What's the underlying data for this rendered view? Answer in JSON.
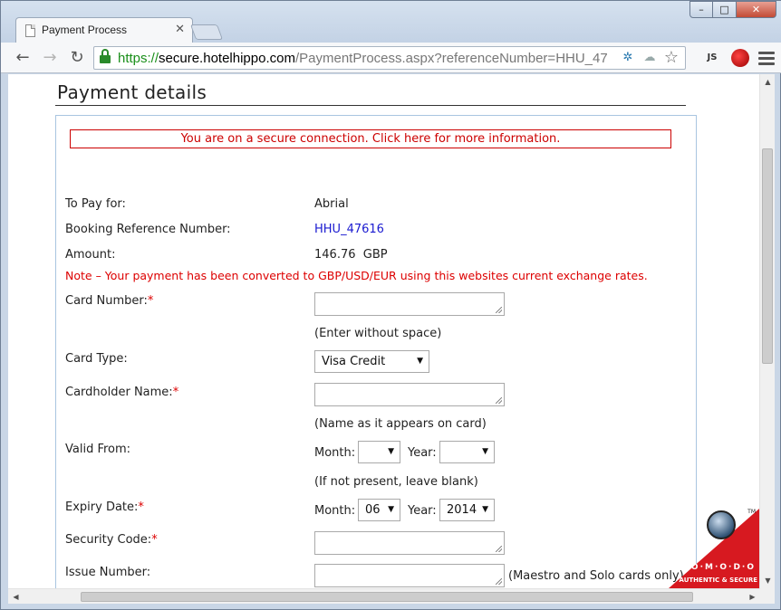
{
  "browser": {
    "tab_title": "Payment Process",
    "url_scheme": "https://",
    "url_host": "secure.hotelhippo.com",
    "url_path": "/PaymentProcess.aspx?referenceNumber=HHU_47",
    "win_min": "–",
    "win_max": "□",
    "win_close": "✕",
    "back": "←",
    "forward": "→",
    "reload": "↻",
    "star": "☆",
    "js_label": "JS"
  },
  "page": {
    "title": "Payment details",
    "secure_notice": "You are on a secure connection. Click here for more information.",
    "to_pay_label": "To Pay for:",
    "to_pay_value": "Abrial",
    "booking_ref_label": "Booking Reference Number:",
    "booking_ref_value": "HHU_47616",
    "amount_label": "Amount:",
    "amount_value": "146.76  GBP",
    "note": "Note – Your payment has been converted to GBP/USD/EUR using this websites current exchange rates.",
    "card_number_label": "Card Number:",
    "card_number_hint": "(Enter without space)",
    "card_type_label": "Card Type:",
    "card_type_value": "Visa Credit",
    "cardholder_label": "Cardholder Name:",
    "cardholder_hint": "(Name as it appears on card)",
    "valid_from_label": "Valid From:",
    "valid_from_hint": "(If not present, leave blank)",
    "expiry_label": "Expiry Date:",
    "security_label": "Security Code:",
    "issue_label": "Issue Number:",
    "issue_hint": "(Maestro and Solo cards only)",
    "month_label": "Month:",
    "year_label": "Year:",
    "valid_from_month": "",
    "valid_from_year": "",
    "expiry_month": "06",
    "expiry_year": "2014",
    "required_mark": "*"
  },
  "badge": {
    "brand": "C·O·M·O·D·O",
    "tagline": "AUTHENTIC & SECURE",
    "tm": "TM"
  }
}
